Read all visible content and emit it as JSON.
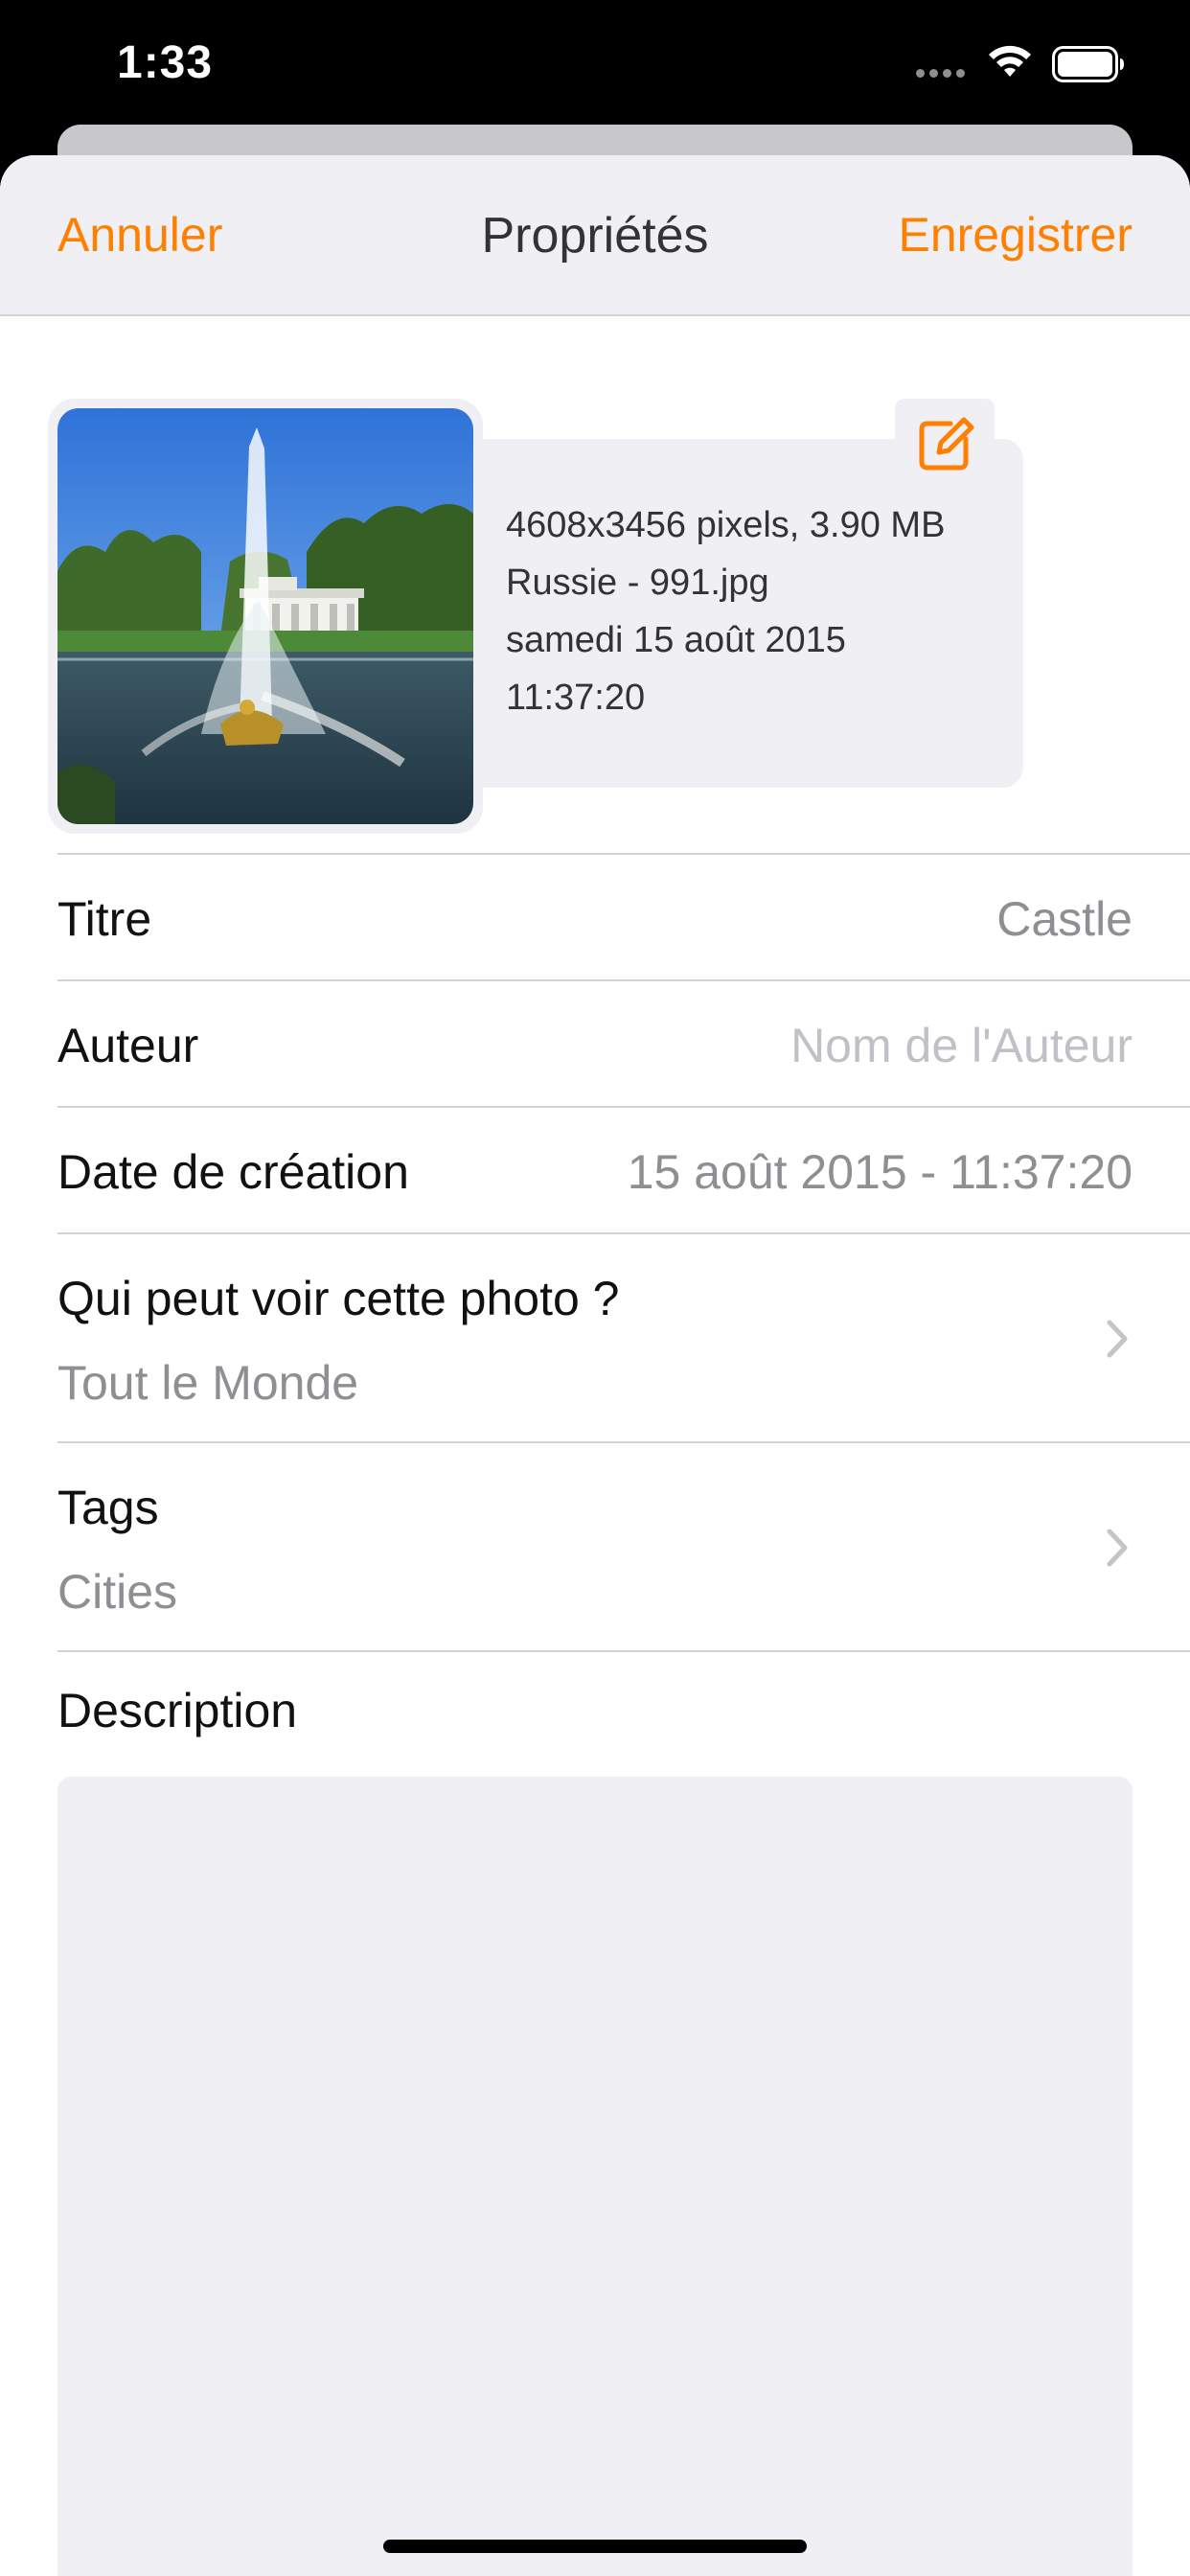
{
  "status_bar": {
    "time": "1:33",
    "icons": [
      "cellular-signal-icon",
      "wifi-icon",
      "battery-icon"
    ]
  },
  "nav": {
    "cancel_label": "Annuler",
    "title": "Propriétés",
    "save_label": "Enregistrer"
  },
  "photo": {
    "alt": "Fontaine avec palais",
    "info_lines": [
      "4608x3456 pixels, 3.90 MB",
      "Russie - 991.jpg",
      "samedi 15 août 2015",
      "11:37:20"
    ],
    "edit_icon": "edit-icon"
  },
  "fields": {
    "title": {
      "label": "Titre",
      "value": "Castle"
    },
    "author": {
      "label": "Auteur",
      "placeholder": "Nom de l'Auteur",
      "value": ""
    },
    "creation_date": {
      "label": "Date de création",
      "value": "15 août 2015 - 11:37:20"
    },
    "visibility": {
      "label": "Qui peut voir cette photo ?",
      "value": "Tout le Monde"
    },
    "tags": {
      "label": "Tags",
      "value": "Cities"
    },
    "description": {
      "label": "Description",
      "value": ""
    }
  },
  "colors": {
    "accent": "#ff7f00",
    "grouped_background": "#efeff4",
    "separator": "#d1d1d6",
    "secondary_text": "#8e8e93"
  }
}
